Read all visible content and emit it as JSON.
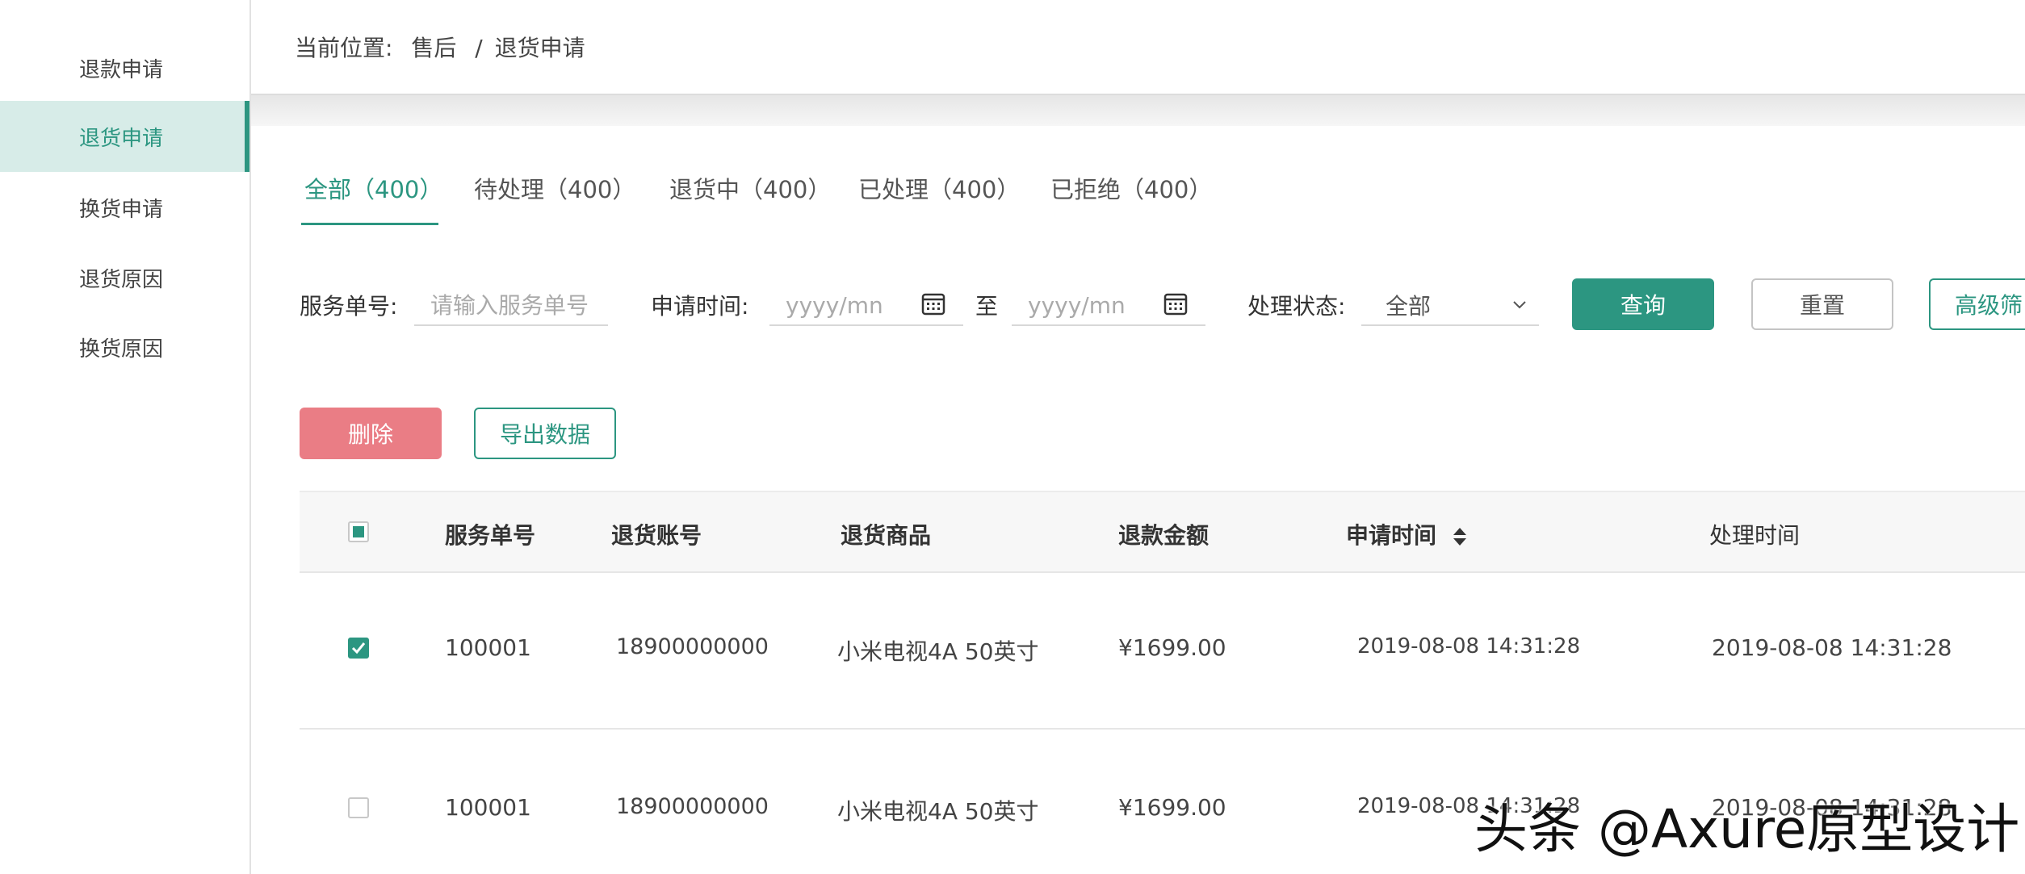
{
  "sidebar": {
    "items": [
      {
        "label": "退款申请"
      },
      {
        "label": "退货申请"
      },
      {
        "label": "换货申请"
      },
      {
        "label": "退货原因"
      },
      {
        "label": "换货原因"
      }
    ],
    "active_index": 1
  },
  "breadcrumb": {
    "prefix": "当前位置:",
    "level1": "售后",
    "separator": "/",
    "level2": "退货申请"
  },
  "tabs": [
    {
      "label": "全部（400）"
    },
    {
      "label": "待处理（400）"
    },
    {
      "label": "退货中（400）"
    },
    {
      "label": "已处理（400）"
    },
    {
      "label": "已拒绝（400）"
    }
  ],
  "filters": {
    "service_no_label": "服务单号:",
    "service_no_placeholder": "请输入服务单号",
    "apply_time_label": "申请时间:",
    "date_from_placeholder": "yyyy/mn",
    "to_label": "至",
    "date_to_placeholder": "yyyy/mn",
    "status_label": "处理状态:",
    "status_value": "全部",
    "query_button": "查询",
    "reset_button": "重置",
    "advanced_button": "高级筛"
  },
  "actions": {
    "delete_button": "删除",
    "export_button": "导出数据"
  },
  "table": {
    "columns": [
      "服务单号",
      "退货账号",
      "退货商品",
      "退款金额",
      "申请时间",
      "处理时间"
    ],
    "rows": [
      {
        "checked": true,
        "service_no": "100001",
        "account": "18900000000",
        "product": "小米电视4A 50英寸",
        "amount": "¥1699.00",
        "apply_time": "2019-08-08 14:31:28",
        "process_time": "2019-08-08 14:31:28"
      },
      {
        "checked": false,
        "service_no": "100001",
        "account": "18900000000",
        "product": "小米电视4A 50英寸",
        "amount": "¥1699.00",
        "apply_time": "2019-08-08 14:31:28",
        "process_time": "2019-08-08 14:31:28"
      }
    ]
  },
  "watermark": "头条 @Axure原型设计",
  "colors": {
    "accent": "#2c9681",
    "active_bg": "#d7ece8",
    "danger": "#ea7d85"
  }
}
